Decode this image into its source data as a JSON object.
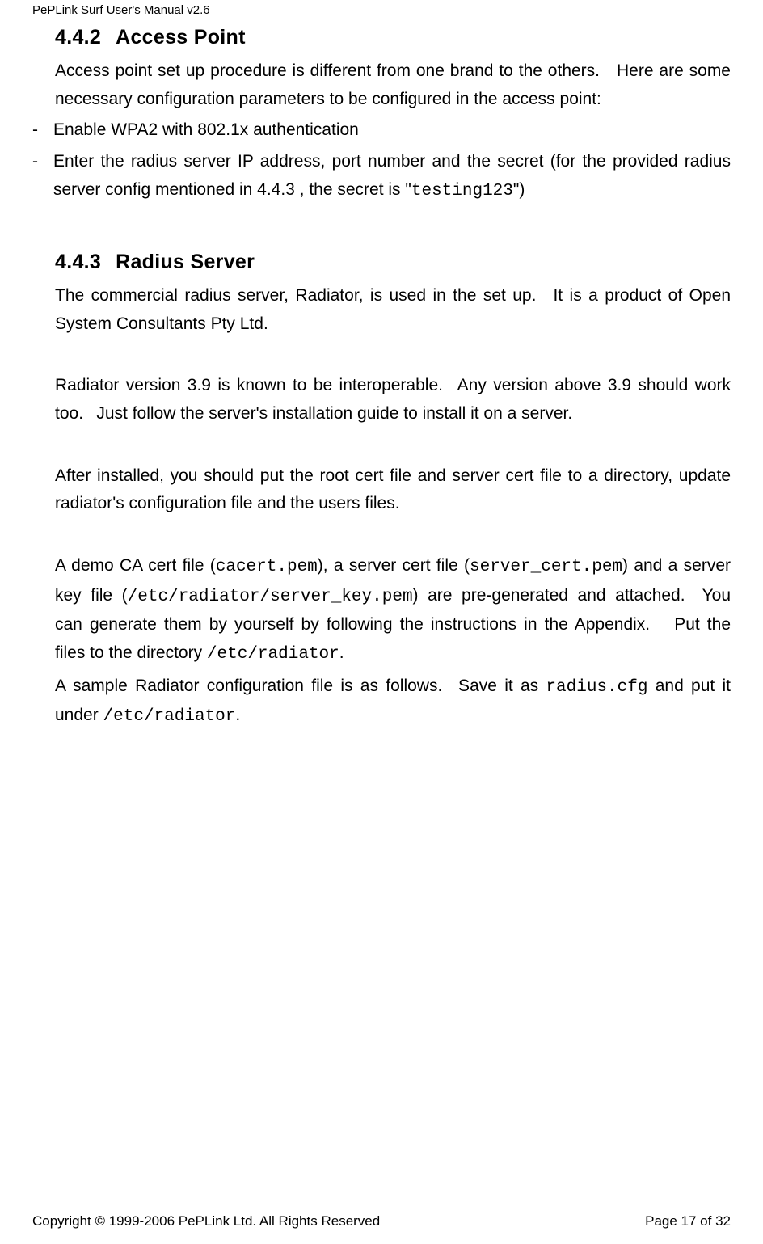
{
  "header": {
    "title": "PePLink Surf User's Manual v2.6"
  },
  "footer": {
    "copyright": "Copyright © 1999-2006 PePLink Ltd. All Rights Reserved",
    "page_label": "Page 17 of 32"
  },
  "sections": {
    "access_point": {
      "number": "4.4.2",
      "title": "Access Point",
      "intro": "Access point set up procedure is different from one brand to the others. Here are some necessary configuration parameters to be configured in the access point:",
      "bullets": [
        "Enable WPA2 with 802.1x authentication",
        "Enter the radius server IP address, port number and the secret (for the provided radius server config mentioned in 4.4.3 , the secret is \""
      ],
      "secret_code": "testing123",
      "bullet2_tail": "\")"
    },
    "radius_server": {
      "number": "4.4.3",
      "title": "Radius Server",
      "p1": "The commercial radius server, Radiator, is used in the set up. It is a product of Open System Consultants Pty Ltd.",
      "p2": "Radiator version 3.9 is known to be interoperable.  Any version above 3.9 should work too.  Just follow the server's installation guide to install it on a server.",
      "p3": "After installed, you should put the root cert file and server cert file to a directory, update radiator's configuration file and the users files.",
      "p4_parts": {
        "t1": "A demo CA cert file (",
        "c1": "cacert.pem",
        "t2": "), a server cert file (",
        "c2": "server_cert.pem",
        "t3": ") and a server key file (",
        "c3": "/etc/radiator/server_key.pem",
        "t4": ") are pre-generated and attached. You can generate them by yourself by following the instructions in the Appendix.  Put the files to the directory ",
        "c4": "/etc/radiator",
        "t5": "."
      },
      "p5_parts": {
        "t1": "A sample Radiator configuration file is as follows.  Save it as ",
        "c1": "radius.cfg",
        "t2": " and put it under ",
        "c2": "/etc/radiator",
        "t3": "."
      }
    }
  }
}
